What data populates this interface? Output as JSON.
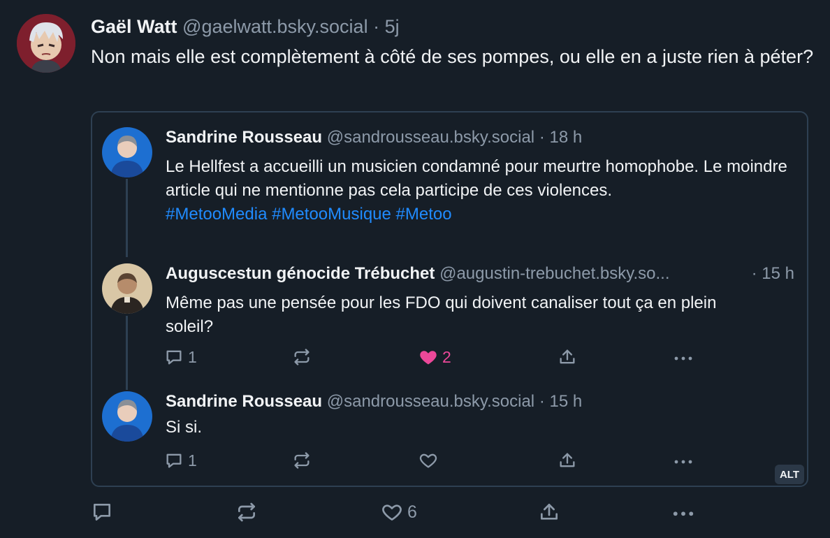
{
  "main_post": {
    "author": "Gaël Watt",
    "handle": "@gaelwatt.bsky.social",
    "separator": "·",
    "time": "5j",
    "text": "Non mais elle est complètement à côté de ses pompes, ou elle en a juste rien à péter?",
    "actions": {
      "reply_count": "",
      "repost_count": "",
      "like_count": "6"
    }
  },
  "quote": {
    "posts": [
      {
        "author": "Sandrine Rousseau",
        "handle": "@sandrousseau.bsky.social",
        "time": "· 18 h",
        "text": "Le Hellfest a accueilli un musicien condamné pour meurtre homophobe. Le moindre article qui ne mentionne pas cela participe de ces violences.",
        "hashtags": [
          "#MetooMedia",
          "#MetooMusique",
          "#Metoo"
        ]
      },
      {
        "author": "Auguscestun génocide Trébuchet",
        "handle": "@augustin-trebuchet.bsky.so...",
        "time": "· 15 h",
        "text": "Même pas une pensée pour les FDO qui doivent canaliser tout ça en plein soleil?",
        "reply_count": "1",
        "like_count": "2"
      },
      {
        "author": "Sandrine Rousseau",
        "handle": "@sandrousseau.bsky.social",
        "time": "· 15 h",
        "text": "Si si.",
        "reply_count": "1"
      }
    ],
    "alt_badge": "ALT"
  },
  "icons": {
    "reply": "reply-icon",
    "repost": "repost-icon",
    "like": "heart-icon",
    "share": "share-icon",
    "more": "more-icon"
  },
  "colors": {
    "background": "#161e27",
    "link": "#208bfe",
    "liked": "#ec4899",
    "muted": "#8d9aa9",
    "border": "#2e4052"
  }
}
